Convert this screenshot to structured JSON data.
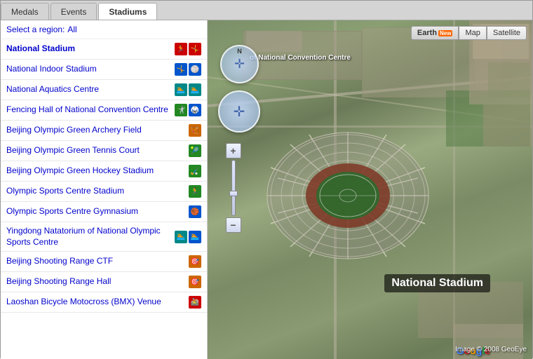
{
  "tabs": [
    {
      "label": "Medals",
      "id": "medals",
      "active": false
    },
    {
      "label": "Events",
      "id": "events",
      "active": false
    },
    {
      "label": "Stadiums",
      "id": "stadiums",
      "active": true
    }
  ],
  "sidebar": {
    "region_label": "Select a region:",
    "region_value": "All",
    "stadiums": [
      {
        "name": "National Stadium",
        "icons": [
          "red-run",
          "red-jump"
        ]
      },
      {
        "name": "National Indoor Stadium",
        "icons": [
          "blue-gymnast",
          "blue-ball"
        ]
      },
      {
        "name": "National Aquatics Centre",
        "icons": [
          "teal-swim",
          "teal-dive"
        ]
      },
      {
        "name": "Fencing Hall of National Convention Centre",
        "icons": [
          "green-fence"
        ]
      },
      {
        "name": "Beijing Olympic Green Archery Field",
        "icons": [
          "orange-arch"
        ]
      },
      {
        "name": "Beijing Olympic Green Tennis Court",
        "icons": [
          "green-tennis"
        ]
      },
      {
        "name": "Beijing Olympic Green Hockey Stadium",
        "icons": [
          "green-hockey"
        ]
      },
      {
        "name": "Olympic Sports Centre Stadium",
        "icons": [
          "green-run"
        ]
      },
      {
        "name": "Olympic Sports Centre Gymnasium",
        "icons": [
          "blue-gymnastics"
        ]
      },
      {
        "name": "Yingdong Natatorium of National Olympic Sports Centre",
        "icons": [
          "teal-swim2",
          "blue-dive"
        ]
      },
      {
        "name": "Beijing Shooting Range CTF",
        "icons": [
          "orange-shoot"
        ]
      },
      {
        "name": "Beijing Shooting Range Hall",
        "icons": [
          "orange-shoot2"
        ]
      },
      {
        "name": "Laoshan Bicycle Motocross (BMX) Venue",
        "icons": [
          "red-bike"
        ]
      }
    ]
  },
  "map": {
    "controls": {
      "earth_label": "Earth",
      "earth_new_badge": "New",
      "map_label": "Map",
      "satellite_label": "Satellite"
    },
    "compass": {
      "north": "N"
    },
    "stadium_label": "National Stadium",
    "convention_centre_label": "of National Convention Centre",
    "copyright": "Image © 2008 GeoEye",
    "google_logo": "Google"
  }
}
